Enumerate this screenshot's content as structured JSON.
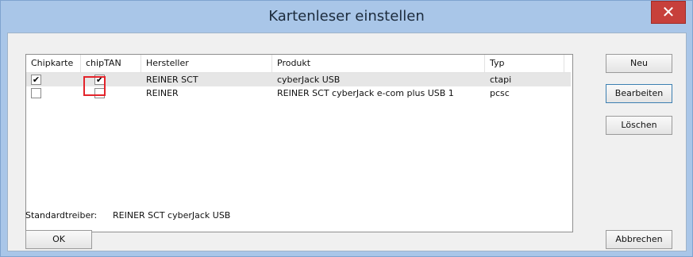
{
  "window": {
    "title": "Kartenleser einstellen",
    "close_symbol": "✕"
  },
  "list": {
    "columns": [
      "Chipkarte",
      "chipTAN",
      "Hersteller",
      "Produkt",
      "Typ"
    ],
    "rows": [
      {
        "chipkarte": true,
        "chiptan": true,
        "hersteller": "REINER SCT",
        "produkt": "cyberJack USB",
        "typ": "ctapi",
        "selected": true
      },
      {
        "chipkarte": false,
        "chiptan": false,
        "hersteller": "REINER",
        "produkt": "REINER SCT cyberJack e-com plus USB 1",
        "typ": "pcsc",
        "selected": false
      }
    ],
    "check_mark": "✔"
  },
  "standard": {
    "label": "Standardtreiber:",
    "value": "REINER SCT cyberJack USB"
  },
  "buttons": {
    "neu": "Neu",
    "bearbeiten": "Bearbeiten",
    "loeschen": "Löschen",
    "ok": "OK",
    "abbrechen": "Abbrechen"
  },
  "colors": {
    "titlebar": "#a9c6e8",
    "close": "#c7403b",
    "highlight": "#e3242b"
  }
}
